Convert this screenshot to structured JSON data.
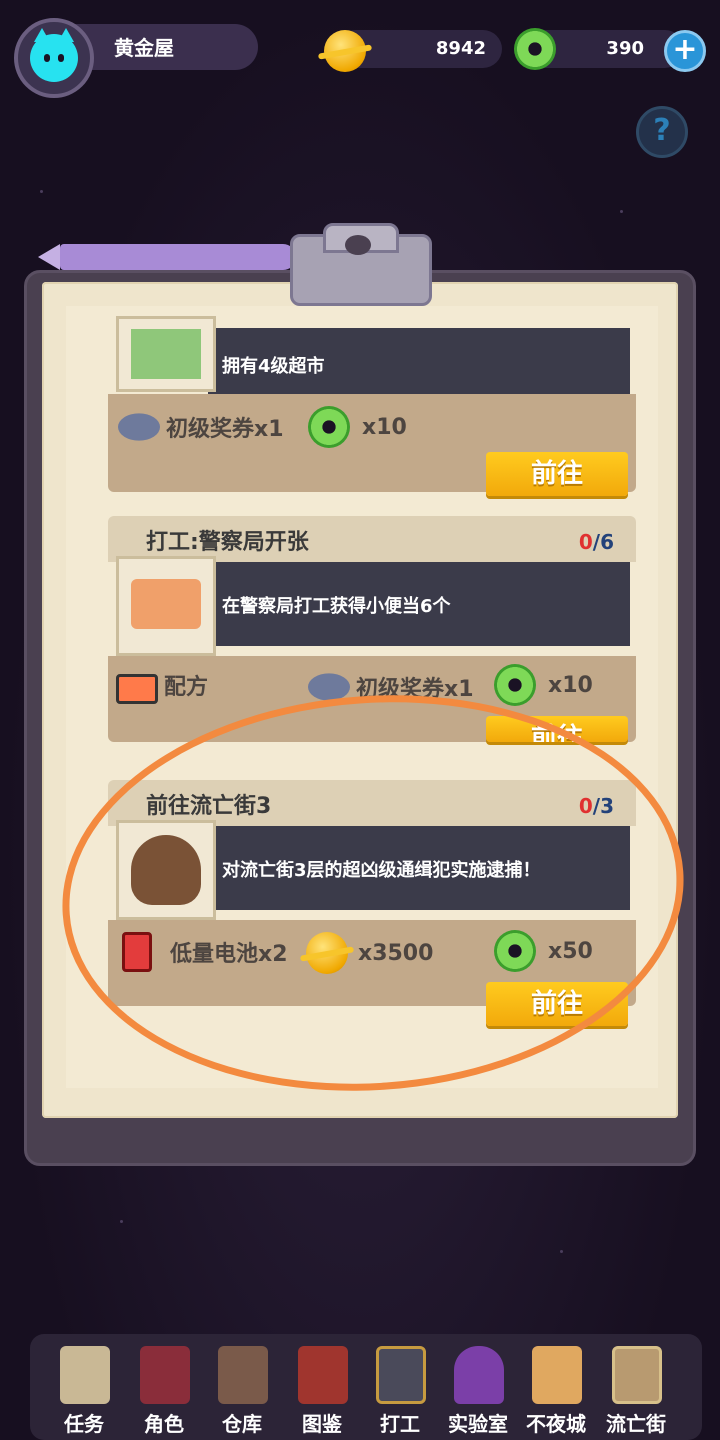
{
  "player": {
    "name": "黄金屋"
  },
  "currencies": {
    "gold": "8942",
    "donut": "390"
  },
  "tasks": [
    {
      "title": "",
      "description": "拥有4级超市",
      "rewards": [
        {
          "icon": "ticket-icon",
          "label": "初级奖券x1"
        },
        {
          "icon": "donut-icon",
          "label": "x10"
        }
      ],
      "button": "前往"
    },
    {
      "title": "打工:警察局开张",
      "progress_current": "0",
      "progress_total": "/6",
      "description": "在警察局打工获得小便当6个",
      "rewards": [
        {
          "icon": "bento-icon",
          "label": "配方"
        },
        {
          "icon": "ticket-icon",
          "label": "初级奖券x1"
        },
        {
          "icon": "donut-icon",
          "label": "x10"
        }
      ],
      "button": "前往"
    },
    {
      "title": "前往流亡街3",
      "progress_current": "0",
      "progress_total": "/3",
      "description": "对流亡街3层的超凶级通缉犯实施逮捕！",
      "rewards": [
        {
          "icon": "battery-icon",
          "label": "低量电池x2"
        },
        {
          "icon": "gold-coin-icon",
          "label": "x3500"
        },
        {
          "icon": "donut-icon",
          "label": "x50"
        }
      ],
      "button": "前往"
    }
  ],
  "nav": [
    "任务",
    "角色",
    "仓库",
    "图鉴",
    "打工",
    "实验室",
    "不夜城",
    "流亡街"
  ],
  "colors": {
    "accent": "#f38a3f",
    "button": "#f7b814",
    "progress_current": "#e03030"
  }
}
